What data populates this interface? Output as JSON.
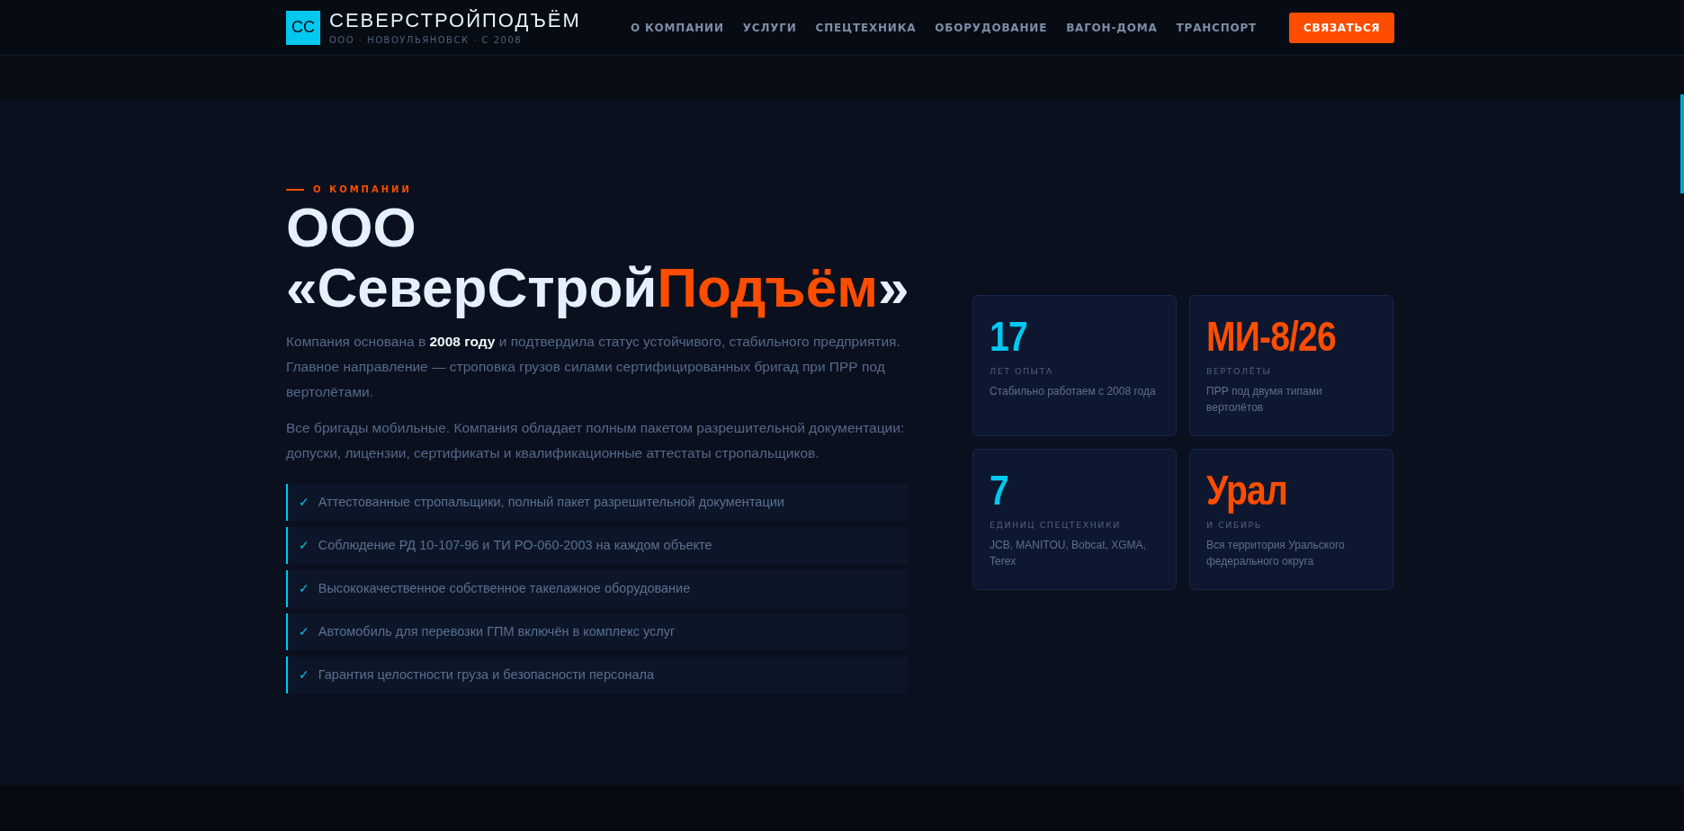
{
  "header": {
    "logo_mark": "СС",
    "brand": "СЕВЕРСТРОЙПОДЪЁМ",
    "tagline": "ООО · НОВОУЛЬЯНОВСК · С 2008",
    "nav": [
      {
        "label": "О КОМПАНИИ"
      },
      {
        "label": "УСЛУГИ"
      },
      {
        "label": "СПЕЦТЕХНИКА"
      },
      {
        "label": "ОБОРУДОВАНИЕ"
      },
      {
        "label": "ВАГОН-ДОМА"
      },
      {
        "label": "ТРАНСПОРТ"
      }
    ],
    "cta": "СВЯЗАТЬСЯ"
  },
  "about": {
    "eyebrow": "О КОМПАНИИ",
    "title_lines": [
      "ООО",
      "«СеверСтрой"
    ],
    "title_accent": "Подъём",
    "title_end": "»",
    "paragraphs": [
      "Компания основана в **2008 году** и подтвердила статус устойчивого, стабильного предприятия. Главное направление — строповка грузов силами сертифицированных бригад при ПРР под вертолётами.",
      "Все бригады мобильные. Компания обладает полным пакетом разрешительной документации: допуски, лицензии, сертификаты и квалификационные аттестаты стропальщиков."
    ],
    "features": [
      {
        "mark": "✓",
        "text": "Аттестованные стропальщики, полный пакет разрешительной документации"
      },
      {
        "mark": "✓",
        "text": "Соблюдение РД 10-107-96 и ТИ РО-060-2003 на каждом объекте"
      },
      {
        "mark": "✓",
        "text": "Высококачественное собственное такелажное оборудование"
      },
      {
        "mark": "✓",
        "text": "Автомобиль для перевозки ГПМ включён в комплекс услуг"
      },
      {
        "mark": "✓",
        "text": "Гарантия целостности груза и безопасности персонала"
      }
    ],
    "stats": [
      {
        "value": "17",
        "color": "#00c8f0",
        "label": "ЛЕТ ОПЫТА",
        "description": "Стабильно работаем с 2008 года"
      },
      {
        "value": "МИ-8/26",
        "color": "#ff4d00",
        "label": "ВЕРТОЛЁТЫ",
        "description": "ПРР под двумя типами вертолётов"
      },
      {
        "value": "7",
        "color": "#00c8f0",
        "label": "ЕДИНИЦ СПЕЦТЕХНИКИ",
        "description": "JCB, MANITOU, Bobcat, XGMA, Terex"
      },
      {
        "value": "Урал",
        "color": "#ff4d00",
        "label": "И СИБИРЬ",
        "description": "Вся территория Уральского федерального округа"
      }
    ]
  }
}
